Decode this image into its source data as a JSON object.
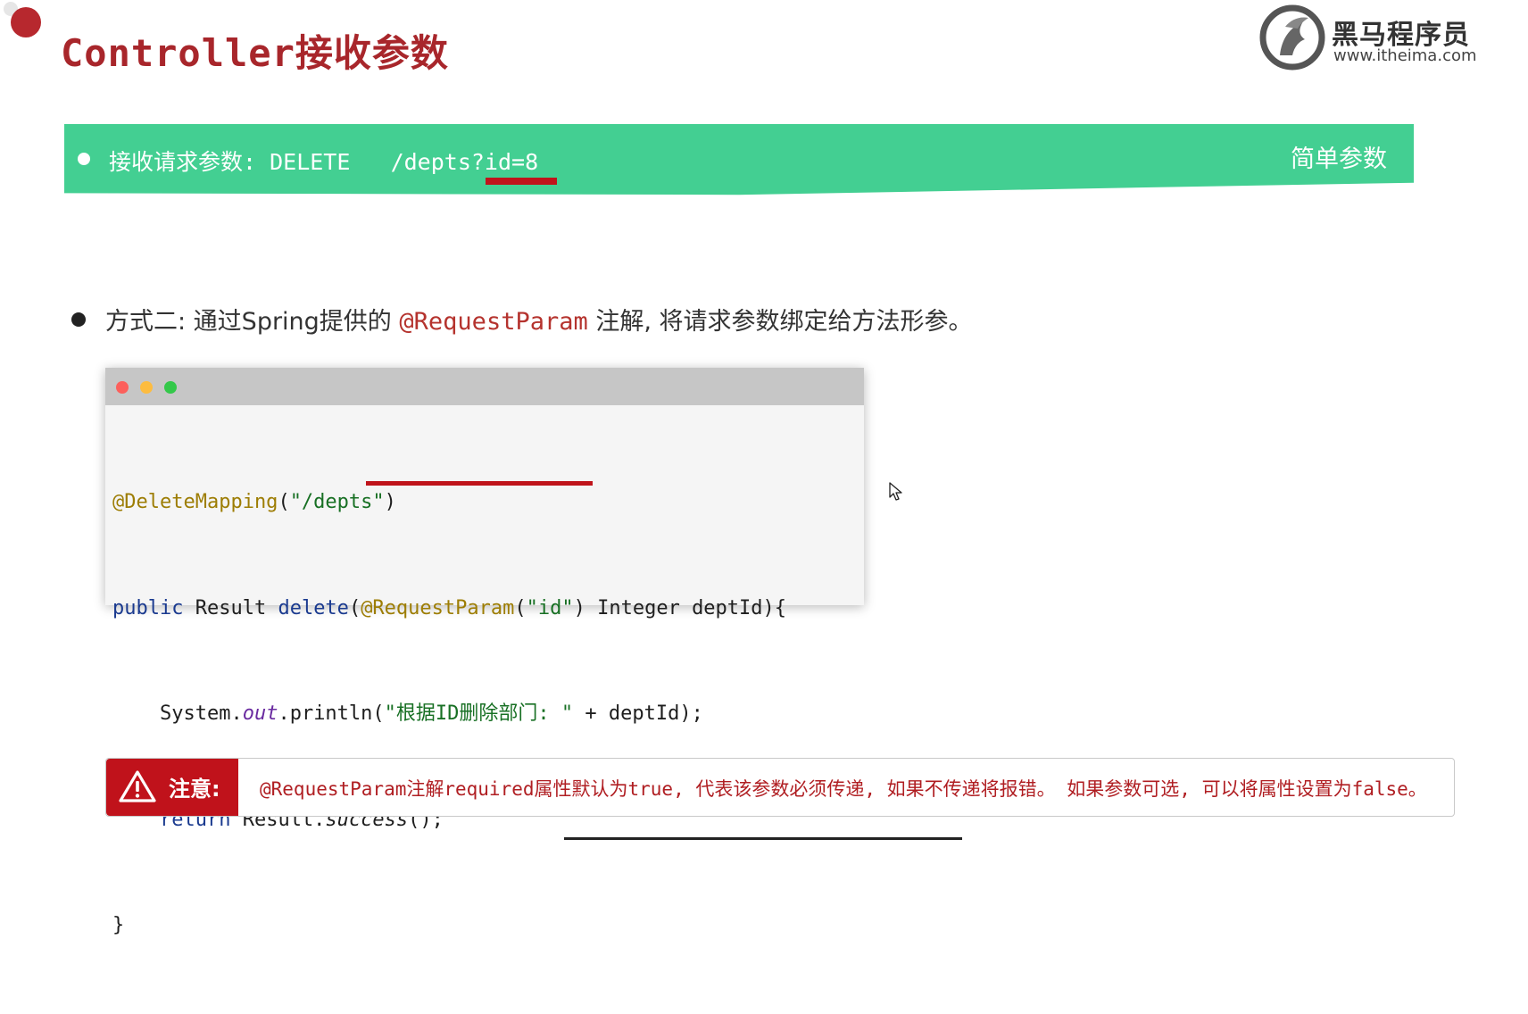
{
  "slide": {
    "title": "Controller接收参数"
  },
  "logo": {
    "name": "黑马程序员",
    "url": "www.itheima.com"
  },
  "banner": {
    "text": "接收请求参数: DELETE   /depts?id=8",
    "tag": "简单参数",
    "color": "#43cf92"
  },
  "method": {
    "prefix": "方式二: 通过Spring提供的 ",
    "annotation": "@RequestParam",
    "suffix": " 注解, 将请求参数绑定给方法形参。"
  },
  "code": {
    "line1": {
      "annot": "@DeleteMapping",
      "open": "(",
      "str": "\"/depts\"",
      "close": ")"
    },
    "line2": {
      "kw": "public",
      "plain1": " Result ",
      "method": "delete",
      "paren": "(",
      "annot": "@RequestParam",
      "open": "(",
      "str": "\"id\"",
      "close": ")",
      "rest": " Integer deptId){"
    },
    "line3": {
      "indent": "    ",
      "plain": "System.",
      "field": "out",
      "call": ".println(",
      "str": "\"根据ID删除部门: \"",
      "rest": " + deptId);"
    },
    "line4": {
      "indent": "    ",
      "kw": "return",
      "plain": " Result.",
      "method": "success",
      "rest": "();"
    },
    "line5": "}"
  },
  "note": {
    "label": "注意:",
    "text": "@RequestParam注解required属性默认为true, 代表该参数必须传递, 如果不传递将报错。 如果参数可选, 可以将属性设置为false。"
  },
  "icons": [
    "warning-icon",
    "cursor-icon",
    "logo-emblem-icon"
  ],
  "colors": {
    "accent": "#a8262b",
    "banner": "#43cf92",
    "warning": "#c0121b"
  }
}
